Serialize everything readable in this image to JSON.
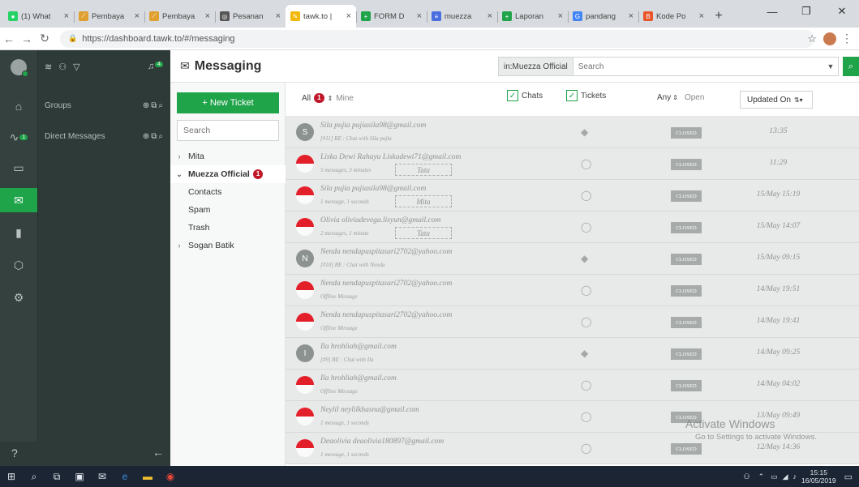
{
  "browser": {
    "tabs": [
      {
        "title": "(1) What",
        "fav_color": "#25d366",
        "fav_glyph": "●"
      },
      {
        "title": "Pembaya",
        "fav_color": "#e0a030",
        "fav_glyph": "⟋"
      },
      {
        "title": "Pembaya",
        "fav_color": "#e0a030",
        "fav_glyph": "⟋"
      },
      {
        "title": "Pesanan",
        "fav_color": "#555555",
        "fav_glyph": "◎"
      },
      {
        "title": "tawk.to |",
        "fav_color": "#f2b90c",
        "fav_glyph": "✎",
        "active": true
      },
      {
        "title": "FORM D",
        "fav_color": "#1fa44a",
        "fav_glyph": "+"
      },
      {
        "title": "muezza",
        "fav_color": "#4a6ee0",
        "fav_glyph": "≡"
      },
      {
        "title": "Laporan",
        "fav_color": "#1fa44a",
        "fav_glyph": "+"
      },
      {
        "title": "pandang",
        "fav_color": "#4285f4",
        "fav_glyph": "G"
      },
      {
        "title": "Kode Po",
        "fav_color": "#e8562a",
        "fav_glyph": "B"
      }
    ],
    "url": "https://dashboard.tawk.to/#/messaging"
  },
  "sidebar": {
    "top_badge": "4",
    "rail_badge": "1",
    "groups_label": "Groups",
    "direct_label": "Direct Messages"
  },
  "header": {
    "title": "Messaging",
    "scope": "in:Muezza Official",
    "search_placeholder": "Search"
  },
  "folders": {
    "new_ticket": "+ New Ticket",
    "search_placeholder": "Search",
    "items": [
      {
        "label": "Mita",
        "chevron": "›"
      },
      {
        "label": "Muezza Official",
        "chevron": "⌄",
        "badge": "1",
        "selected": true
      },
      {
        "label": "Contacts"
      },
      {
        "label": "Spam"
      },
      {
        "label": "Trash"
      },
      {
        "label": "Sogan Batik",
        "chevron": "›"
      }
    ]
  },
  "list_header": {
    "all_label": "All",
    "all_badge": "1",
    "mine_label": "Mine",
    "chats_label": "Chats",
    "tickets_label": "Tickets",
    "any_label": "Any",
    "open_label": "Open",
    "sort_label": "Updated On"
  },
  "rows": [
    {
      "avatar": "grey",
      "initial": "S",
      "name": "Sila pujia pujiasila98@gmail.com",
      "sub": "[#11] RE : Chat with Sila pujia",
      "agent": "",
      "type": "ticket",
      "status": "CLOSED",
      "time": "13:35"
    },
    {
      "avatar": "flag",
      "initial": "",
      "name": "Liska Dewi Rahayu Liskadewi71@gmail.com",
      "sub": "5 messages, 3 minutes",
      "agent": "Tata",
      "type": "chat",
      "status": "CLOSED",
      "time": "11:29"
    },
    {
      "avatar": "flag",
      "initial": "",
      "name": "Sila pujia pujiasila98@gmail.com",
      "sub": "1 message, 1 seconds",
      "agent": "Mita",
      "type": "chat",
      "status": "CLOSED",
      "time": "15/May 15:19"
    },
    {
      "avatar": "flag",
      "initial": "",
      "name": "Olivia oliviadevega.lisyun@gmail.com",
      "sub": "2 messages, 1 minute",
      "agent": "Tata",
      "type": "chat",
      "status": "CLOSED",
      "time": "15/May 14:07"
    },
    {
      "avatar": "grey",
      "initial": "N",
      "name": "Nenda nendapuspitasari2702@yahoo.com",
      "sub": "[#10] RE : Chat with Nenda",
      "agent": "",
      "type": "ticket",
      "status": "CLOSED",
      "time": "15/May 09:15"
    },
    {
      "avatar": "flag",
      "initial": "",
      "name": "Nenda nendapuspitasari2702@yahoo.com",
      "sub": "Offline Message",
      "agent": "",
      "type": "chat",
      "status": "CLOSED",
      "time": "14/May 19:51"
    },
    {
      "avatar": "flag",
      "initial": "",
      "name": "Nenda nendapuspitasari2702@yahoo.com",
      "sub": "Offline Message",
      "agent": "",
      "type": "chat",
      "status": "CLOSED",
      "time": "14/May 19:41"
    },
    {
      "avatar": "grey",
      "initial": "I",
      "name": "Ila hrohliah@gmail.com",
      "sub": "[#9] RE : Chat with Ila",
      "agent": "",
      "type": "ticket",
      "status": "CLOSED",
      "time": "14/May 09:25"
    },
    {
      "avatar": "flag",
      "initial": "",
      "name": "Ila hrohliah@gmail.com",
      "sub": "Offline Message",
      "agent": "",
      "type": "chat",
      "status": "CLOSED",
      "time": "14/May 04:02"
    },
    {
      "avatar": "flag",
      "initial": "",
      "name": "Neylil neylilkhasna@gmail.com",
      "sub": "1 message, 1 seconds",
      "agent": "",
      "type": "chat",
      "status": "CLOSED",
      "time": "13/May 09:49"
    },
    {
      "avatar": "flag",
      "initial": "",
      "name": "Deaolivia deaolivia180897@gmail.com",
      "sub": "1 message, 1 seconds",
      "agent": "",
      "type": "chat",
      "status": "CLOSED",
      "time": "12/May 14:36"
    }
  ],
  "watermark": {
    "line1": "Activate Windows",
    "line2": "Go to Settings to activate Windows."
  },
  "taskbar": {
    "time": "15:15",
    "date": "16/05/2019"
  },
  "colors": {
    "accent": "#1fa44a",
    "rail": "#34413f",
    "badge": "#c0182b"
  }
}
